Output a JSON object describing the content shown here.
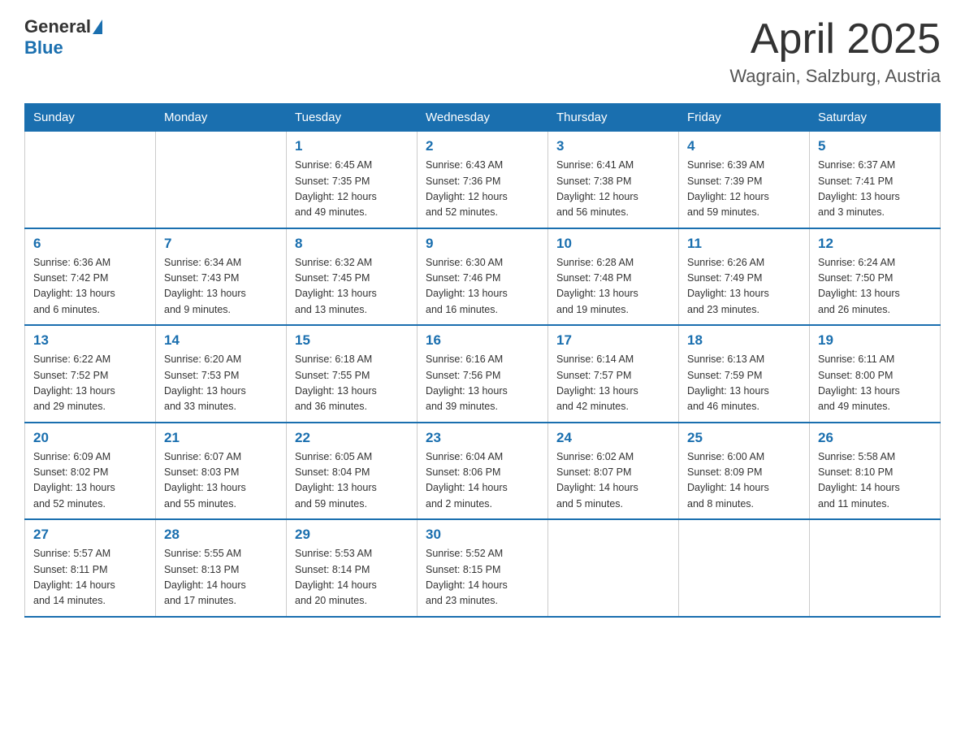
{
  "header": {
    "logo_general": "General",
    "logo_blue": "Blue",
    "title": "April 2025",
    "subtitle": "Wagrain, Salzburg, Austria"
  },
  "weekdays": [
    "Sunday",
    "Monday",
    "Tuesday",
    "Wednesday",
    "Thursday",
    "Friday",
    "Saturday"
  ],
  "weeks": [
    [
      {
        "day": "",
        "info": ""
      },
      {
        "day": "",
        "info": ""
      },
      {
        "day": "1",
        "info": "Sunrise: 6:45 AM\nSunset: 7:35 PM\nDaylight: 12 hours\nand 49 minutes."
      },
      {
        "day": "2",
        "info": "Sunrise: 6:43 AM\nSunset: 7:36 PM\nDaylight: 12 hours\nand 52 minutes."
      },
      {
        "day": "3",
        "info": "Sunrise: 6:41 AM\nSunset: 7:38 PM\nDaylight: 12 hours\nand 56 minutes."
      },
      {
        "day": "4",
        "info": "Sunrise: 6:39 AM\nSunset: 7:39 PM\nDaylight: 12 hours\nand 59 minutes."
      },
      {
        "day": "5",
        "info": "Sunrise: 6:37 AM\nSunset: 7:41 PM\nDaylight: 13 hours\nand 3 minutes."
      }
    ],
    [
      {
        "day": "6",
        "info": "Sunrise: 6:36 AM\nSunset: 7:42 PM\nDaylight: 13 hours\nand 6 minutes."
      },
      {
        "day": "7",
        "info": "Sunrise: 6:34 AM\nSunset: 7:43 PM\nDaylight: 13 hours\nand 9 minutes."
      },
      {
        "day": "8",
        "info": "Sunrise: 6:32 AM\nSunset: 7:45 PM\nDaylight: 13 hours\nand 13 minutes."
      },
      {
        "day": "9",
        "info": "Sunrise: 6:30 AM\nSunset: 7:46 PM\nDaylight: 13 hours\nand 16 minutes."
      },
      {
        "day": "10",
        "info": "Sunrise: 6:28 AM\nSunset: 7:48 PM\nDaylight: 13 hours\nand 19 minutes."
      },
      {
        "day": "11",
        "info": "Sunrise: 6:26 AM\nSunset: 7:49 PM\nDaylight: 13 hours\nand 23 minutes."
      },
      {
        "day": "12",
        "info": "Sunrise: 6:24 AM\nSunset: 7:50 PM\nDaylight: 13 hours\nand 26 minutes."
      }
    ],
    [
      {
        "day": "13",
        "info": "Sunrise: 6:22 AM\nSunset: 7:52 PM\nDaylight: 13 hours\nand 29 minutes."
      },
      {
        "day": "14",
        "info": "Sunrise: 6:20 AM\nSunset: 7:53 PM\nDaylight: 13 hours\nand 33 minutes."
      },
      {
        "day": "15",
        "info": "Sunrise: 6:18 AM\nSunset: 7:55 PM\nDaylight: 13 hours\nand 36 minutes."
      },
      {
        "day": "16",
        "info": "Sunrise: 6:16 AM\nSunset: 7:56 PM\nDaylight: 13 hours\nand 39 minutes."
      },
      {
        "day": "17",
        "info": "Sunrise: 6:14 AM\nSunset: 7:57 PM\nDaylight: 13 hours\nand 42 minutes."
      },
      {
        "day": "18",
        "info": "Sunrise: 6:13 AM\nSunset: 7:59 PM\nDaylight: 13 hours\nand 46 minutes."
      },
      {
        "day": "19",
        "info": "Sunrise: 6:11 AM\nSunset: 8:00 PM\nDaylight: 13 hours\nand 49 minutes."
      }
    ],
    [
      {
        "day": "20",
        "info": "Sunrise: 6:09 AM\nSunset: 8:02 PM\nDaylight: 13 hours\nand 52 minutes."
      },
      {
        "day": "21",
        "info": "Sunrise: 6:07 AM\nSunset: 8:03 PM\nDaylight: 13 hours\nand 55 minutes."
      },
      {
        "day": "22",
        "info": "Sunrise: 6:05 AM\nSunset: 8:04 PM\nDaylight: 13 hours\nand 59 minutes."
      },
      {
        "day": "23",
        "info": "Sunrise: 6:04 AM\nSunset: 8:06 PM\nDaylight: 14 hours\nand 2 minutes."
      },
      {
        "day": "24",
        "info": "Sunrise: 6:02 AM\nSunset: 8:07 PM\nDaylight: 14 hours\nand 5 minutes."
      },
      {
        "day": "25",
        "info": "Sunrise: 6:00 AM\nSunset: 8:09 PM\nDaylight: 14 hours\nand 8 minutes."
      },
      {
        "day": "26",
        "info": "Sunrise: 5:58 AM\nSunset: 8:10 PM\nDaylight: 14 hours\nand 11 minutes."
      }
    ],
    [
      {
        "day": "27",
        "info": "Sunrise: 5:57 AM\nSunset: 8:11 PM\nDaylight: 14 hours\nand 14 minutes."
      },
      {
        "day": "28",
        "info": "Sunrise: 5:55 AM\nSunset: 8:13 PM\nDaylight: 14 hours\nand 17 minutes."
      },
      {
        "day": "29",
        "info": "Sunrise: 5:53 AM\nSunset: 8:14 PM\nDaylight: 14 hours\nand 20 minutes."
      },
      {
        "day": "30",
        "info": "Sunrise: 5:52 AM\nSunset: 8:15 PM\nDaylight: 14 hours\nand 23 minutes."
      },
      {
        "day": "",
        "info": ""
      },
      {
        "day": "",
        "info": ""
      },
      {
        "day": "",
        "info": ""
      }
    ]
  ]
}
